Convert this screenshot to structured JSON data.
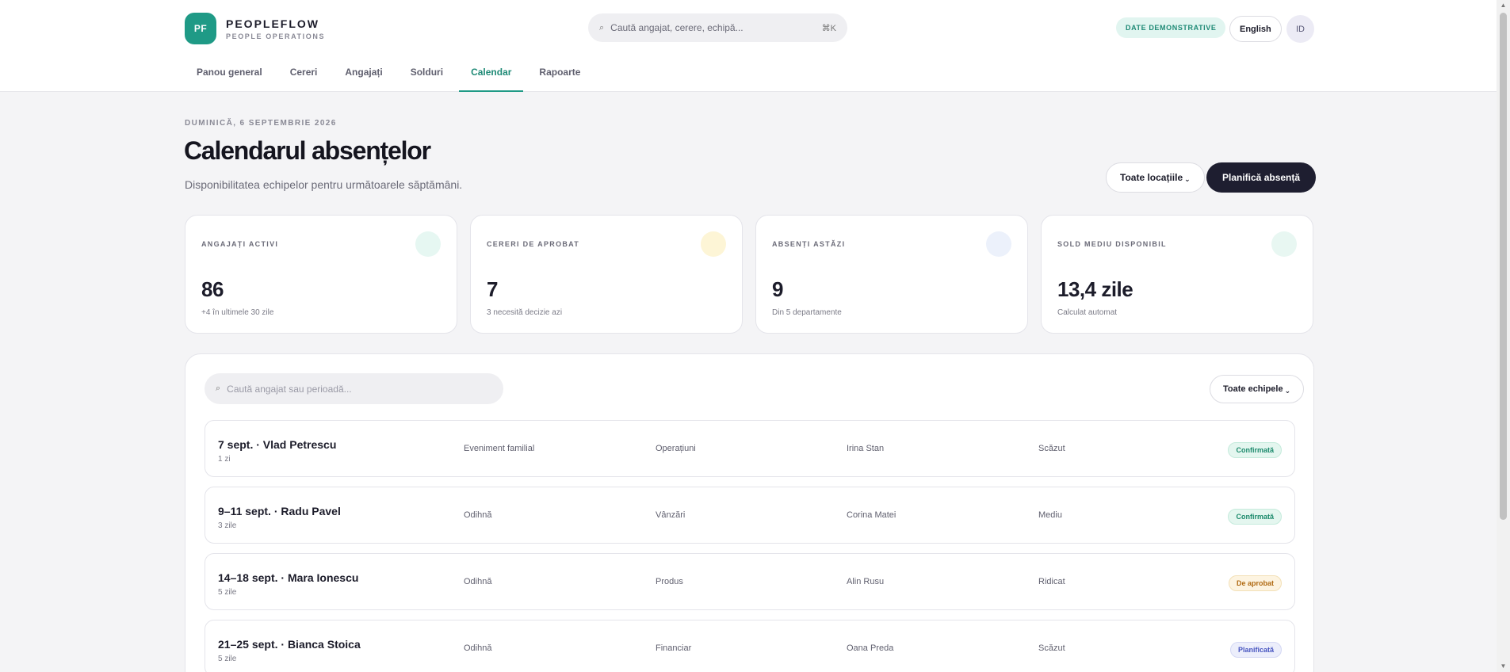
{
  "brand": {
    "logo": "PF",
    "name": "PEOPLEFLOW",
    "subtitle": "PEOPLE OPERATIONS"
  },
  "search": {
    "placeholder": "Caută angajat, cerere, echipă...",
    "shortcut": "⌘K",
    "icon": "search-icon"
  },
  "header": {
    "demo_badge": "DATE DEMONSTRATIVE",
    "language": "English",
    "avatar": "ID"
  },
  "nav": {
    "active": "Calendar",
    "items": [
      {
        "label": "Panou general"
      },
      {
        "label": "Cereri"
      },
      {
        "label": "Angajați"
      },
      {
        "label": "Solduri"
      },
      {
        "label": "Calendar"
      },
      {
        "label": "Rapoarte"
      }
    ]
  },
  "page": {
    "date": "DUMINICĂ, 6 SEPTEMBRIE 2026",
    "title": "Calendarul absențelor",
    "subtitle": "Disponibilitatea echipelor pentru următoarele săptămâni.",
    "locations_button": "Toate locațiile",
    "plan_button": "Planifică absență"
  },
  "stats": [
    {
      "label": "ANGAJAȚI ACTIVI",
      "value": "86",
      "note": "+4 în ultimele 30 zile",
      "color": "#e6f7f2"
    },
    {
      "label": "CERERI DE APROBAT",
      "value": "7",
      "note": "3 necesită decizie azi",
      "color": "#fdf5d6"
    },
    {
      "label": "ABSENȚI ASTĂZI",
      "value": "9",
      "note": "Din 5 departamente",
      "color": "#ecf1fb"
    },
    {
      "label": "SOLD MEDIU DISPONIBIL",
      "value": "13,4 zile",
      "note": "Calculat automat",
      "color": "#e8f7f2"
    }
  ],
  "panel": {
    "search_placeholder": "Caută angajat sau perioadă...",
    "teams_button": "Toate echipele"
  },
  "rows": [
    {
      "title": "7 sept. · Vlad Petrescu",
      "duration": "1 zi",
      "type": "Eveniment familial",
      "department": "Operațiuni",
      "approver": "Irina Stan",
      "impact": "Scăzut",
      "status": "Confirmată",
      "status_kind": "confirmed"
    },
    {
      "title": "9–11 sept. · Radu Pavel",
      "duration": "3 zile",
      "type": "Odihnă",
      "department": "Vânzări",
      "approver": "Corina Matei",
      "impact": "Mediu",
      "status": "Confirmată",
      "status_kind": "confirmed"
    },
    {
      "title": "14–18 sept. · Mara Ionescu",
      "duration": "5 zile",
      "type": "Odihnă",
      "department": "Produs",
      "approver": "Alin Rusu",
      "impact": "Ridicat",
      "status": "De aprobat",
      "status_kind": "pending"
    },
    {
      "title": "21–25 sept. · Bianca Stoica",
      "duration": "5 zile",
      "type": "Odihnă",
      "department": "Financiar",
      "approver": "Oana Preda",
      "impact": "Scăzut",
      "status": "Planificată",
      "status_kind": "planned"
    }
  ]
}
